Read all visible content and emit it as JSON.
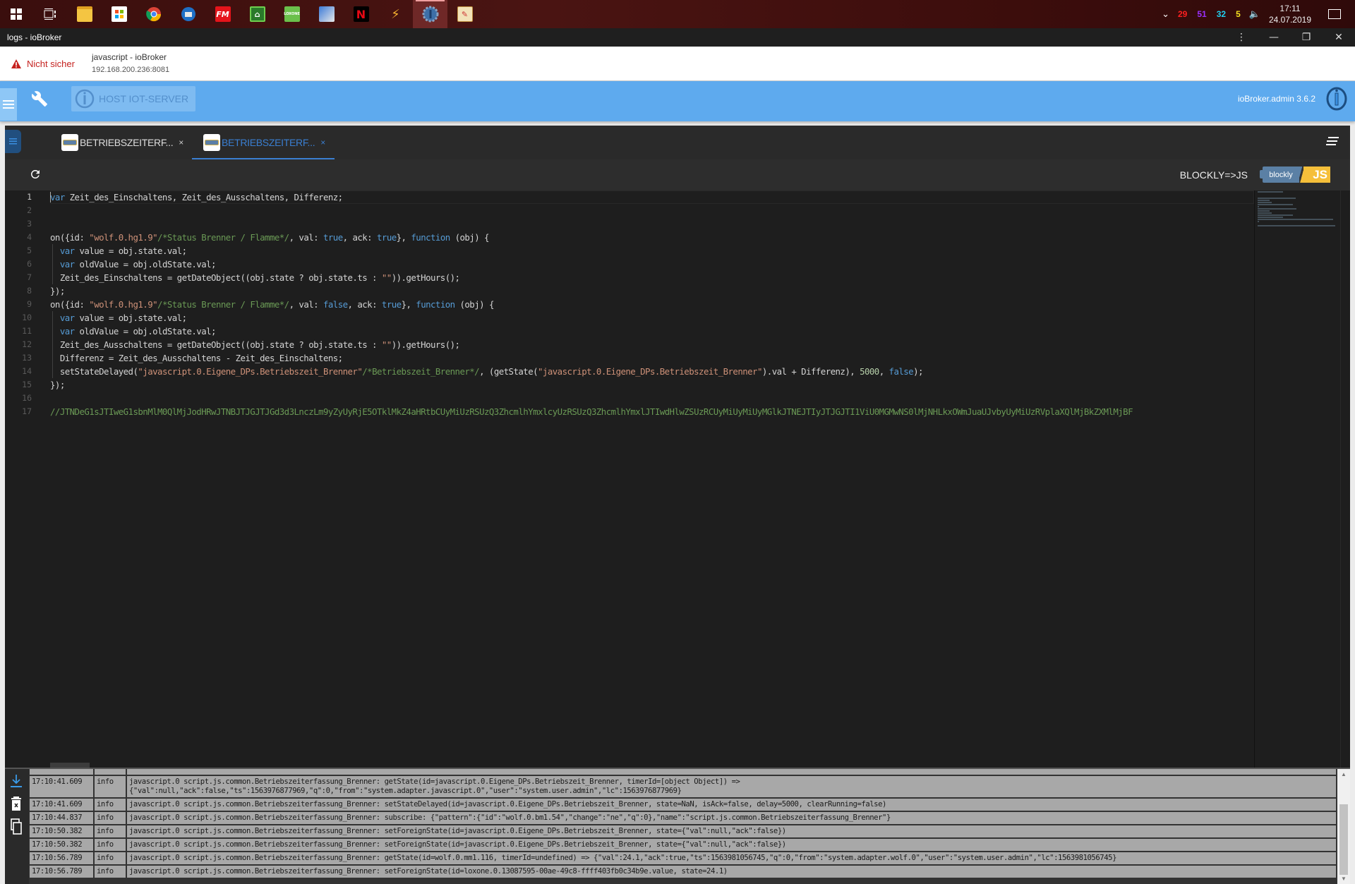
{
  "taskbar": {
    "apps": [
      {
        "name": "windows-start",
        "label": "",
        "active": false
      },
      {
        "name": "task-view",
        "label": "",
        "active": false
      },
      {
        "name": "file-explorer",
        "label": "",
        "active": false
      },
      {
        "name": "microsoft-store",
        "label": "",
        "active": false
      },
      {
        "name": "chrome",
        "label": "",
        "active": true
      },
      {
        "name": "thunderbird",
        "label": "",
        "active": false
      },
      {
        "name": "fm",
        "label": "FM",
        "active": false
      },
      {
        "name": "home-app",
        "label": "",
        "active": false
      },
      {
        "name": "loxone",
        "label": "LOXONE",
        "active": false
      },
      {
        "name": "remote-desktop",
        "label": "",
        "active": false
      },
      {
        "name": "netflix",
        "label": "N",
        "active": false
      },
      {
        "name": "winamp",
        "label": "",
        "active": false
      },
      {
        "name": "iobroker",
        "label": "",
        "active": true
      },
      {
        "name": "document-app",
        "label": "",
        "active": false
      }
    ],
    "tray": {
      "counters": [
        {
          "value": "29",
          "color": "#ff2020"
        },
        {
          "value": "51",
          "color": "#9a2fff"
        },
        {
          "value": "32",
          "color": "#20d0f0"
        },
        {
          "value": "5",
          "color": "#f4e020"
        }
      ],
      "time": "17:11",
      "date": "24.07.2019"
    }
  },
  "window": {
    "title": "logs - ioBroker"
  },
  "urlbar": {
    "security_label": "Nicht sicher",
    "page_title": "javascript - ioBroker",
    "host": "192.168.200.236:8081"
  },
  "header": {
    "host_button": "HOST IOT-SERVER",
    "admin_version": "ioBroker.admin 3.6.2",
    "accent": "#5eaaee"
  },
  "tabs": [
    {
      "label": "BETRIEBSZEITERF...",
      "close": "×",
      "active": false
    },
    {
      "label": "BETRIEBSZEITERF...",
      "close": "×",
      "active": true
    }
  ],
  "toolbar": {
    "convert_label": "BLOCKLY=>JS",
    "badge_left": "blockly",
    "badge_right": "JS"
  },
  "editor": {
    "lines": [
      {
        "n": "1",
        "html": "<span class=\"kw\">var</span> Zeit_des_Einschaltens, Zeit_des_Ausschaltens, Differenz;"
      },
      {
        "n": "2",
        "html": ""
      },
      {
        "n": "3",
        "html": ""
      },
      {
        "n": "4",
        "html": "on({id: <span class=\"str\">\"wolf.0.hg1.9\"</span><span class=\"cm\">/*Status Brenner / Flamme*/</span>, val: <span class=\"kw\">true</span>, ack: <span class=\"kw\">true</span>}, <span class=\"kw\">function</span> (obj) {"
      },
      {
        "n": "5",
        "html": "  <span class=\"kw\">var</span> value = obj.state.val;"
      },
      {
        "n": "6",
        "html": "  <span class=\"kw\">var</span> oldValue = obj.oldState.val;"
      },
      {
        "n": "7",
        "html": "  Zeit_des_Einschaltens = getDateObject((obj.state ? obj.state.ts : <span class=\"str\">\"\"</span>)).getHours();"
      },
      {
        "n": "8",
        "html": "});"
      },
      {
        "n": "9",
        "html": "on({id: <span class=\"str\">\"wolf.0.hg1.9\"</span><span class=\"cm\">/*Status Brenner / Flamme*/</span>, val: <span class=\"kw\">false</span>, ack: <span class=\"kw\">true</span>}, <span class=\"kw\">function</span> (obj) {"
      },
      {
        "n": "10",
        "html": "  <span class=\"kw\">var</span> value = obj.state.val;"
      },
      {
        "n": "11",
        "html": "  <span class=\"kw\">var</span> oldValue = obj.oldState.val;"
      },
      {
        "n": "12",
        "html": "  Zeit_des_Ausschaltens = getDateObject((obj.state ? obj.state.ts : <span class=\"str\">\"\"</span>)).getHours();"
      },
      {
        "n": "13",
        "html": "  Differenz = Zeit_des_Ausschaltens - Zeit_des_Einschaltens;"
      },
      {
        "n": "14",
        "html": "  setStateDelayed(<span class=\"str\">\"javascript.0.Eigene_DPs.Betriebszeit_Brenner\"</span><span class=\"cm\">/*Betriebszeit_Brenner*/</span>, (getState(<span class=\"str\">\"javascript.0.Eigene_DPs.Betriebszeit_Brenner\"</span>).val + Differenz), <span class=\"num\">5000</span>, <span class=\"kw\">false</span>);"
      },
      {
        "n": "15",
        "html": "});"
      },
      {
        "n": "16",
        "html": ""
      },
      {
        "n": "17",
        "html": "<span class=\"cm\">//JTNDeG1sJTIweG1sbnMlM0QlMjJodHRwJTNBJTJGJTJGd3d3LnczLm9yZyUyRjE5OTklMkZ4aHRtbCUyMiUzRSUzQ3ZhcmlhYmxlcyUzRSUzQ3ZhcmlhYmxlJTIwdHlwZSUzRCUyMiUyMiUyMGlkJTNEJTIyJTJGJTI1ViU0MGMwNS0lMjNHLkxOWmJuaUJvbyUyMiUzRVplaXQlMjBkZXMlMjBF</span>"
      }
    ]
  },
  "log": {
    "rows": [
      {
        "time": "17:10:41.609",
        "severity": "info",
        "message": "javascript.0 script.js.common.Betriebszeiterfassung_Brenner: getState(id=javascript.0.Eigene_DPs.Betriebszeit_Brenner, timerId=[object Object]) =>\n{\"val\":null,\"ack\":false,\"ts\":1563976877969,\"q\":0,\"from\":\"system.adapter.javascript.0\",\"user\":\"system.user.admin\",\"lc\":1563976877969}"
      },
      {
        "time": "17:10:41.609",
        "severity": "info",
        "message": "javascript.0 script.js.common.Betriebszeiterfassung_Brenner: setStateDelayed(id=javascript.0.Eigene_DPs.Betriebszeit_Brenner, state=NaN, isAck=false, delay=5000, clearRunning=false)"
      },
      {
        "time": "17:10:44.837",
        "severity": "info",
        "message": "javascript.0 script.js.common.Betriebszeiterfassung_Brenner: subscribe: {\"pattern\":{\"id\":\"wolf.0.bm1.54\",\"change\":\"ne\",\"q\":0},\"name\":\"script.js.common.Betriebszeiterfassung_Brenner\"}"
      },
      {
        "time": "17:10:50.382",
        "severity": "info",
        "message": "javascript.0 script.js.common.Betriebszeiterfassung_Brenner: setForeignState(id=javascript.0.Eigene_DPs.Betriebszeit_Brenner, state={\"val\":null,\"ack\":false})"
      },
      {
        "time": "17:10:50.382",
        "severity": "info",
        "message": "javascript.0 script.js.common.Betriebszeiterfassung_Brenner: setForeignState(id=javascript.0.Eigene_DPs.Betriebszeit_Brenner, state={\"val\":null,\"ack\":false})"
      },
      {
        "time": "17:10:56.789",
        "severity": "info",
        "message": "javascript.0 script.js.common.Betriebszeiterfassung_Brenner: getState(id=wolf.0.mm1.116, timerId=undefined) => {\"val\":24.1,\"ack\":true,\"ts\":1563981056745,\"q\":0,\"from\":\"system.adapter.wolf.0\",\"user\":\"system.user.admin\",\"lc\":1563981056745}"
      },
      {
        "time": "17:10:56.789",
        "severity": "info",
        "message": "javascript.0 script.js.common.Betriebszeiterfassung_Brenner: setForeignState(id=loxone.0.13087595-00ae-49c8-ffff403fb0c34b9e.value, state=24.1)"
      }
    ]
  }
}
